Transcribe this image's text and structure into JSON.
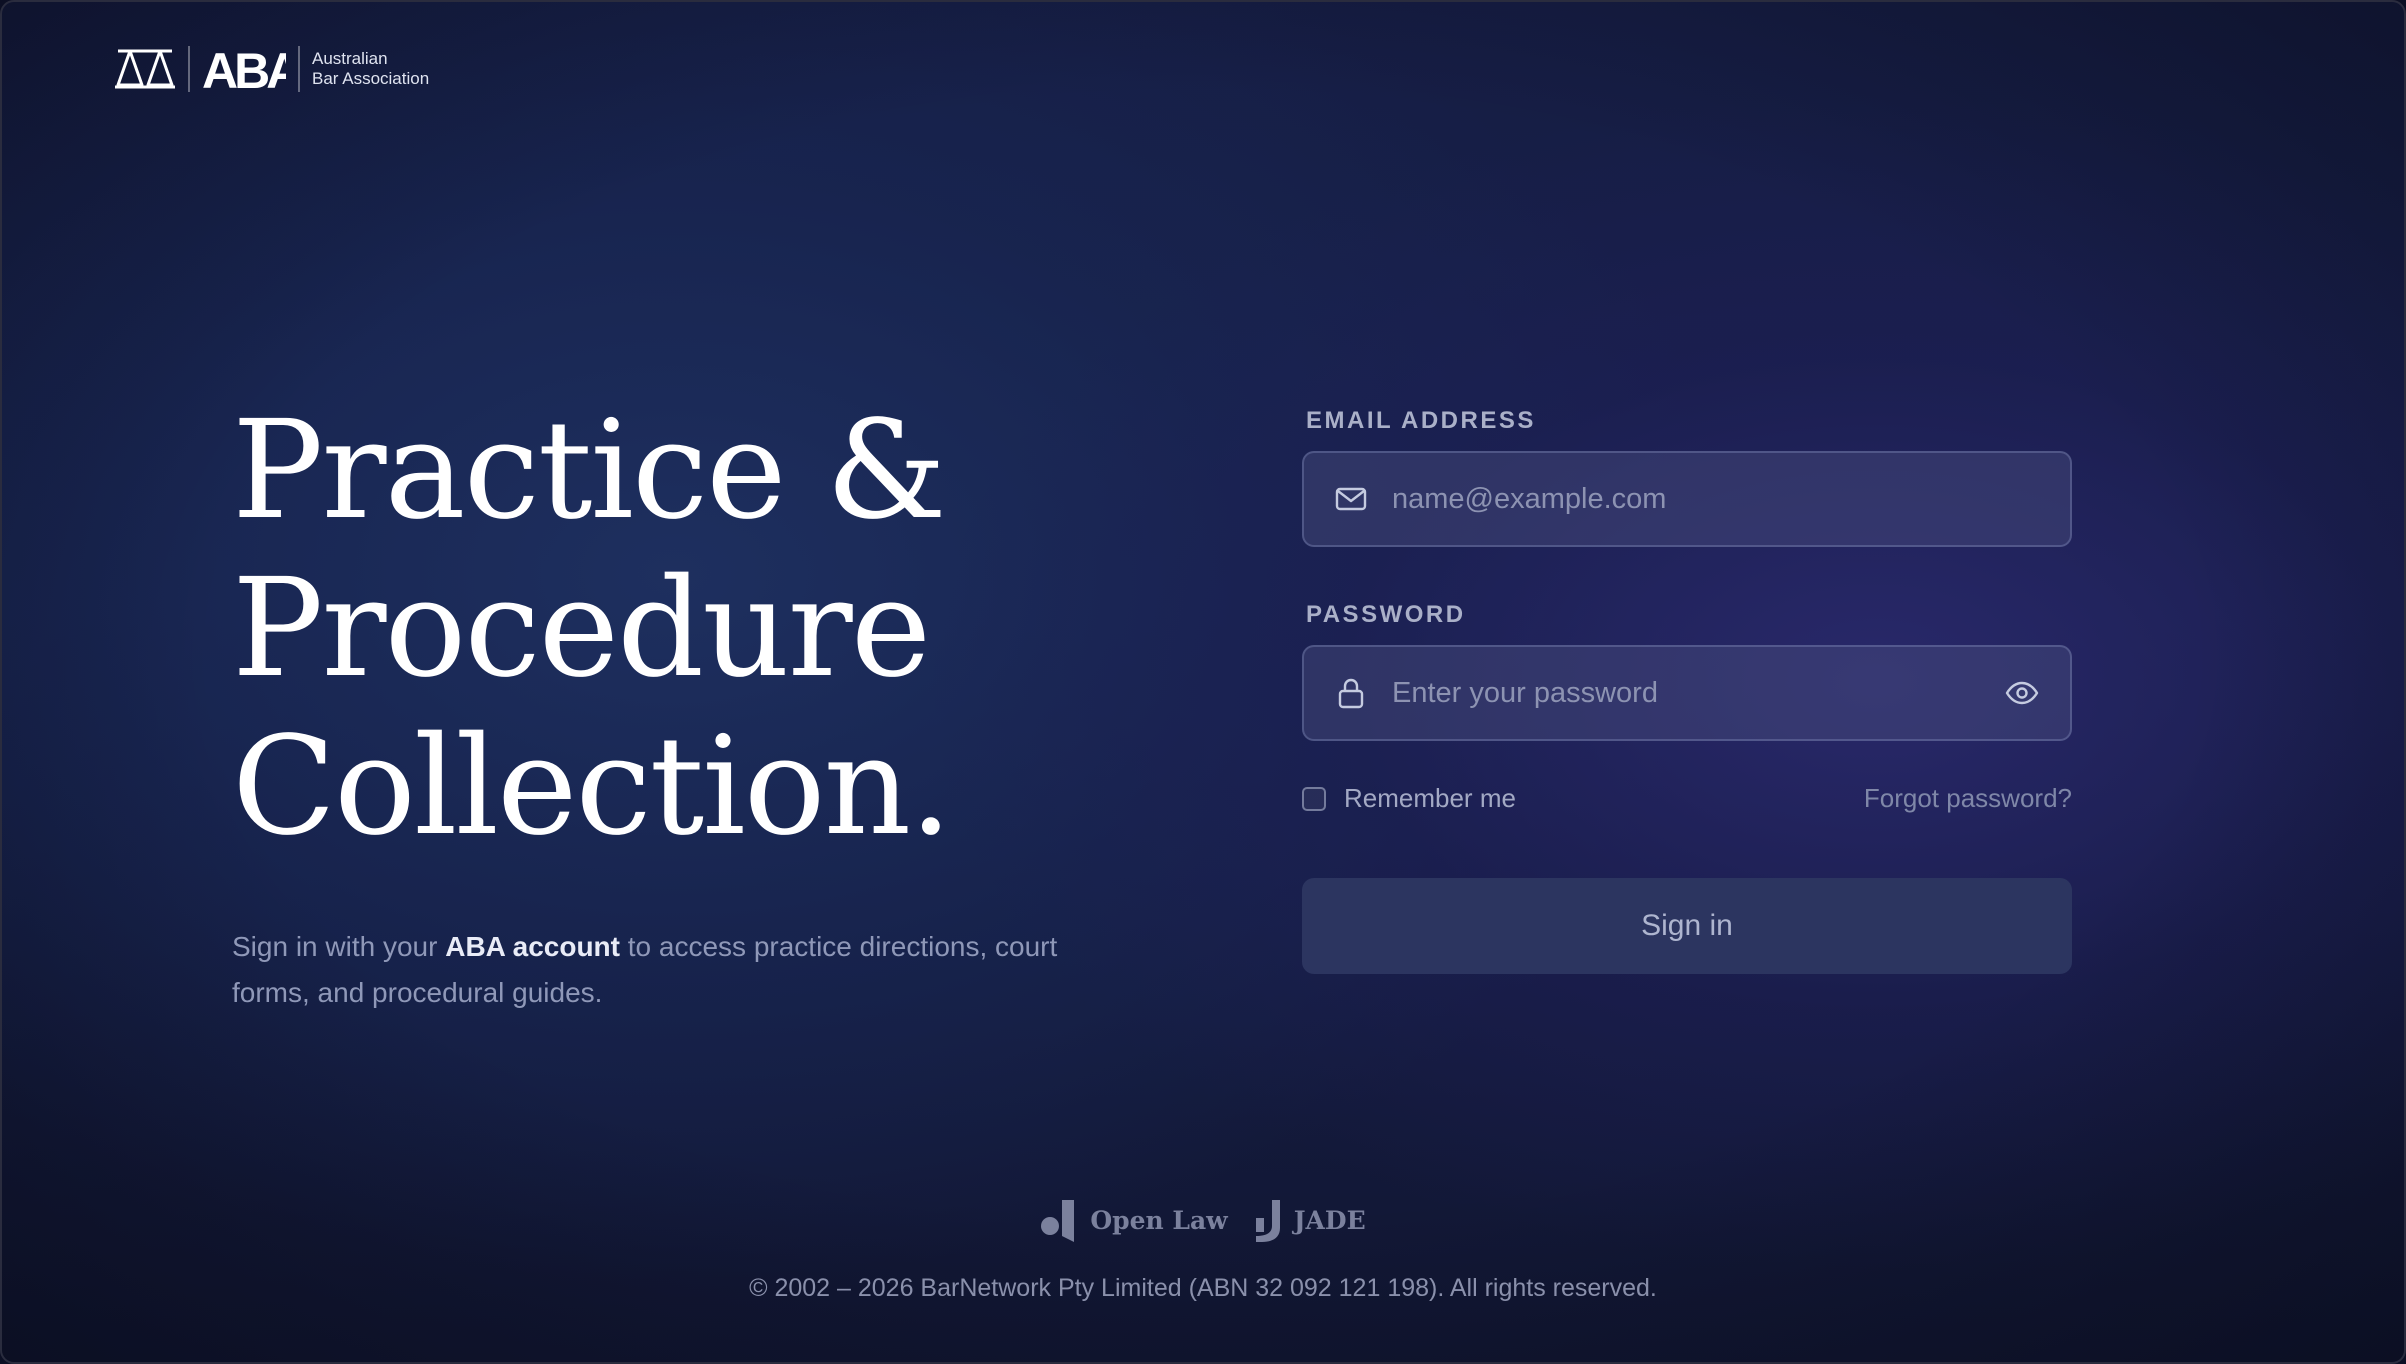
{
  "header": {
    "logo_mark": "ABA",
    "org_line1": "Australian",
    "org_line2": "Bar Association"
  },
  "hero": {
    "title_line1": "Practice &",
    "title_line2": "Procedure",
    "title_line3": "Collection.",
    "subtitle_before": "Sign in with your ",
    "subtitle_strong": "ABA account",
    "subtitle_after": " to access practice directions, court forms, and procedural guides."
  },
  "form": {
    "email_label": "EMAIL ADDRESS",
    "email_placeholder": "name@example.com",
    "email_value": "",
    "password_label": "PASSWORD",
    "password_placeholder": "Enter your password",
    "password_value": "",
    "remember_label": "Remember me",
    "remember_checked": false,
    "forgot_label": "Forgot password?",
    "signin_label": "Sign in"
  },
  "footer": {
    "partners": [
      "Open Law",
      "JADE"
    ],
    "copyright": "© 2002 – 2026 BarNetwork Pty Limited (ABN 32 092 121 198). All rights reserved."
  },
  "icons": {
    "logo": "scales-of-justice-icon",
    "email": "mail-icon",
    "password": "lock-icon",
    "toggle": "eye-icon"
  },
  "colors": {
    "background": "#17204a",
    "button": "#2c3560",
    "field": "#3a3f6a"
  }
}
